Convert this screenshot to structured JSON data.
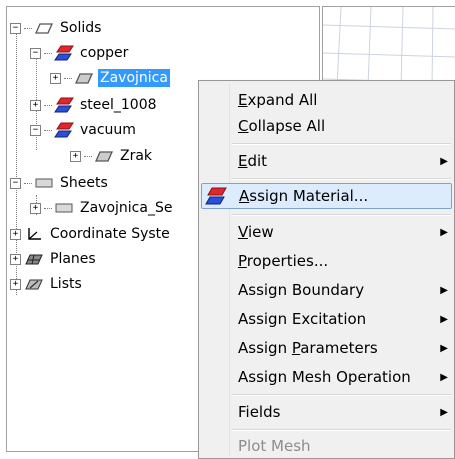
{
  "tree": {
    "items": [
      {
        "label": "Solids",
        "expander": "−",
        "icon": "solids-icon"
      },
      {
        "label": "copper",
        "expander": "−",
        "icon": "material-icon"
      },
      {
        "label": "Zavojnica",
        "expander": "+",
        "icon": "solid-object-icon",
        "selected": true
      },
      {
        "label": "steel_1008",
        "expander": "+",
        "icon": "material-icon"
      },
      {
        "label": "vacuum",
        "expander": "−",
        "icon": "material-icon"
      },
      {
        "label": "Zrak",
        "expander": "+",
        "icon": "solid-object-icon"
      },
      {
        "label": "Sheets",
        "expander": "−",
        "icon": "sheets-icon"
      },
      {
        "label": "Zavojnica_Se",
        "expander": "+",
        "icon": "sheet-object-icon"
      },
      {
        "label": "Coordinate Syste",
        "expander": "+",
        "icon": "coordinate-system-icon"
      },
      {
        "label": "Planes",
        "expander": "+",
        "icon": "planes-icon"
      },
      {
        "label": "Lists",
        "expander": "+",
        "icon": "lists-icon"
      }
    ]
  },
  "menu": {
    "items": [
      {
        "pre": "",
        "u": "E",
        "post": "xpand All",
        "arrow": ""
      },
      {
        "pre": "",
        "u": "C",
        "post": "ollapse All",
        "arrow": ""
      },
      {
        "pre": "",
        "u": "E",
        "post": "dit",
        "arrow": "▶"
      },
      {
        "pre": "",
        "u": "A",
        "post": "ssign Material...",
        "arrow": ""
      },
      {
        "pre": "",
        "u": "V",
        "post": "iew",
        "arrow": "▶"
      },
      {
        "pre": "",
        "u": "P",
        "post": "roperties...",
        "arrow": ""
      },
      {
        "pre": "Assign Boundary",
        "u": "",
        "post": "",
        "arrow": "▶"
      },
      {
        "pre": "Assign Excitation",
        "u": "",
        "post": "",
        "arrow": "▶"
      },
      {
        "pre": "Assign ",
        "u": "P",
        "post": "arameters",
        "arrow": "▶"
      },
      {
        "pre": "Assign Mesh Operation",
        "u": "",
        "post": "",
        "arrow": "▶"
      },
      {
        "pre": "Fields",
        "u": "",
        "post": "",
        "arrow": "▶"
      },
      {
        "pre": "Plot Mesh",
        "u": "",
        "post": "",
        "arrow": ""
      }
    ]
  },
  "colors": {
    "selection": "#3399ff",
    "menu_highlight": "#dcecfc",
    "menu_highlight_border": "#7da2ce",
    "material_red": "#e3262d",
    "material_blue": "#2b4fd6"
  }
}
